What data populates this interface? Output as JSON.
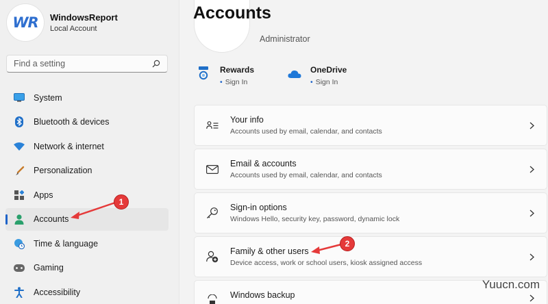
{
  "profile": {
    "name": "WindowsReport",
    "subtitle": "Local Account",
    "avatar_text": "WR"
  },
  "search": {
    "placeholder": "Find a setting"
  },
  "nav": {
    "items": [
      {
        "label": "System",
        "icon": "monitor-icon"
      },
      {
        "label": "Bluetooth & devices",
        "icon": "bluetooth-icon"
      },
      {
        "label": "Network & internet",
        "icon": "wifi-icon"
      },
      {
        "label": "Personalization",
        "icon": "brush-icon"
      },
      {
        "label": "Apps",
        "icon": "apps-icon"
      },
      {
        "label": "Accounts",
        "icon": "person-icon",
        "active": true
      },
      {
        "label": "Time & language",
        "icon": "globe-clock-icon"
      },
      {
        "label": "Gaming",
        "icon": "gamepad-icon"
      },
      {
        "label": "Accessibility",
        "icon": "accessibility-icon"
      }
    ]
  },
  "main": {
    "title": "Accounts",
    "account_type": "Administrator",
    "quick_links": [
      {
        "title": "Rewards",
        "status": "Sign In",
        "icon": "rewards-icon"
      },
      {
        "title": "OneDrive",
        "status": "Sign In",
        "icon": "cloud-icon"
      }
    ],
    "cards": [
      {
        "title": "Your info",
        "subtitle": "Accounts used by email, calendar, and contacts",
        "icon": "contact-card-icon"
      },
      {
        "title": "Email & accounts",
        "subtitle": "Accounts used by email, calendar, and contacts",
        "icon": "mail-icon"
      },
      {
        "title": "Sign-in options",
        "subtitle": "Windows Hello, security key, password, dynamic lock",
        "icon": "key-icon"
      },
      {
        "title": "Family & other users",
        "subtitle": "Device access, work or school users, kiosk assigned access",
        "icon": "add-person-icon"
      },
      {
        "title": "Windows backup",
        "subtitle": "",
        "icon": "backup-icon"
      }
    ]
  },
  "annotations": {
    "step1": "1",
    "step2": "2"
  },
  "watermark": "Yuucn.com",
  "colors": {
    "accent": "#1d62c8",
    "annotation": "#e53a3a"
  }
}
